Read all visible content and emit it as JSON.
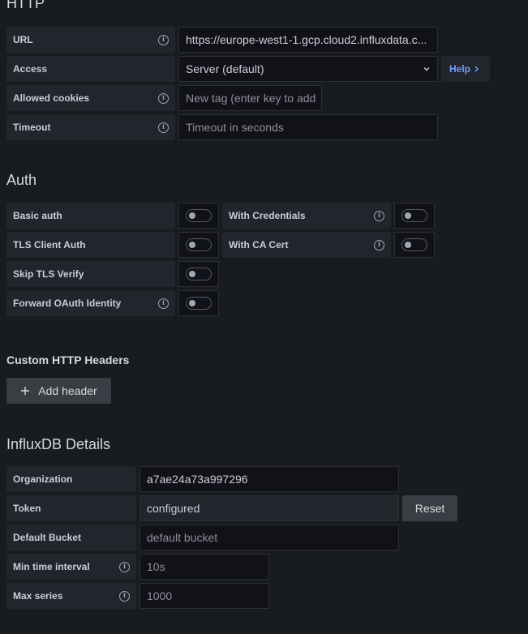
{
  "http": {
    "title": "HTTP",
    "url_label": "URL",
    "url_value": "https://europe-west1-1.gcp.cloud2.influxdata.c...",
    "access_label": "Access",
    "access_value": "Server (default)",
    "help_label": "Help",
    "cookies_label": "Allowed cookies",
    "cookies_placeholder": "New tag (enter key to add",
    "timeout_label": "Timeout",
    "timeout_placeholder": "Timeout in seconds"
  },
  "auth": {
    "title": "Auth",
    "basic_auth": "Basic auth",
    "with_credentials": "With Credentials",
    "tls_client_auth": "TLS Client Auth",
    "with_ca_cert": "With CA Cert",
    "skip_tls_verify": "Skip TLS Verify",
    "forward_oauth": "Forward OAuth Identity"
  },
  "headers": {
    "title": "Custom HTTP Headers",
    "add_label": "Add header"
  },
  "influx": {
    "title": "InfluxDB Details",
    "org_label": "Organization",
    "org_value": "a7ae24a73a997296",
    "token_label": "Token",
    "token_value": "configured",
    "reset_label": "Reset",
    "bucket_label": "Default Bucket",
    "bucket_placeholder": "default bucket",
    "min_interval_label": "Min time interval",
    "min_interval_placeholder": "10s",
    "max_series_label": "Max series",
    "max_series_placeholder": "1000"
  }
}
